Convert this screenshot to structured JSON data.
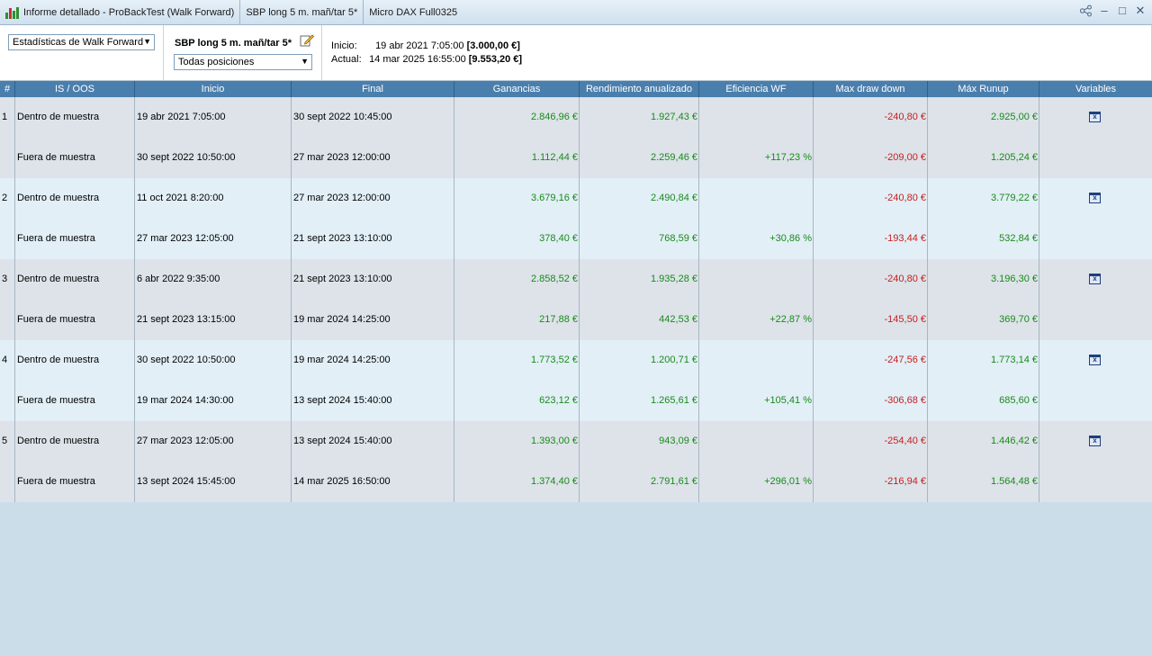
{
  "titlebar": {
    "tab1": "Informe detallado - ProBackTest (Walk Forward)",
    "tab2": "SBP long 5 m. mañ/tar 5*",
    "tab3": "Micro DAX Full0325"
  },
  "toolbar": {
    "view_select": "Estadísticas de Walk Forward",
    "strategy_name": "SBP long 5 m. mañ/tar 5*",
    "positions_select": "Todas posiciones",
    "inicio_label": "Inicio:",
    "inicio_date": "19 abr 2021 7:05:00",
    "inicio_amount": "[3.000,00 €]",
    "actual_label": "Actual:",
    "actual_date": "14 mar 2025 16:55:00",
    "actual_amount": "[9.553,20 €]"
  },
  "table": {
    "headers": [
      "#",
      "IS / OOS",
      "Inicio",
      "Final",
      "Ganancias",
      "Rendimiento anualizado",
      "Eficiencia WF",
      "Max draw down",
      "Máx Runup",
      "Variables"
    ],
    "rows": [
      {
        "num": "1",
        "type": "Dentro de muestra",
        "start": "19 abr 2021 7:05:00",
        "end": "30 sept 2022 10:45:00",
        "gain": "2.846,96 €",
        "annual": "1.927,43 €",
        "eff": "",
        "dd": "-240,80 €",
        "runup": "2.925,00 €",
        "var": true
      },
      {
        "num": "",
        "type": "Fuera de muestra",
        "start": "30 sept 2022 10:50:00",
        "end": "27 mar 2023 12:00:00",
        "gain": "1.112,44 €",
        "annual": "2.259,46 €",
        "eff": "+117,23 %",
        "dd": "-209,00 €",
        "runup": "1.205,24 €",
        "var": false
      },
      {
        "num": "2",
        "type": "Dentro de muestra",
        "start": "11 oct 2021 8:20:00",
        "end": "27 mar 2023 12:00:00",
        "gain": "3.679,16 €",
        "annual": "2.490,84 €",
        "eff": "",
        "dd": "-240,80 €",
        "runup": "3.779,22 €",
        "var": true
      },
      {
        "num": "",
        "type": "Fuera de muestra",
        "start": "27 mar 2023 12:05:00",
        "end": "21 sept 2023 13:10:00",
        "gain": "378,40 €",
        "annual": "768,59 €",
        "eff": "+30,86 %",
        "dd": "-193,44 €",
        "runup": "532,84 €",
        "var": false
      },
      {
        "num": "3",
        "type": "Dentro de muestra",
        "start": "6 abr 2022 9:35:00",
        "end": "21 sept 2023 13:10:00",
        "gain": "2.858,52 €",
        "annual": "1.935,28 €",
        "eff": "",
        "dd": "-240,80 €",
        "runup": "3.196,30 €",
        "var": true
      },
      {
        "num": "",
        "type": "Fuera de muestra",
        "start": "21 sept 2023 13:15:00",
        "end": "19 mar 2024 14:25:00",
        "gain": "217,88 €",
        "annual": "442,53 €",
        "eff": "+22,87 %",
        "dd": "-145,50 €",
        "runup": "369,70 €",
        "var": false
      },
      {
        "num": "4",
        "type": "Dentro de muestra",
        "start": "30 sept 2022 10:50:00",
        "end": "19 mar 2024 14:25:00",
        "gain": "1.773,52 €",
        "annual": "1.200,71 €",
        "eff": "",
        "dd": "-247,56 €",
        "runup": "1.773,14 €",
        "var": true
      },
      {
        "num": "",
        "type": "Fuera de muestra",
        "start": "19 mar 2024 14:30:00",
        "end": "13 sept 2024 15:40:00",
        "gain": "623,12 €",
        "annual": "1.265,61 €",
        "eff": "+105,41 %",
        "dd": "-306,68 €",
        "runup": "685,60 €",
        "var": false
      },
      {
        "num": "5",
        "type": "Dentro de muestra",
        "start": "27 mar 2023 12:05:00",
        "end": "13 sept 2024 15:40:00",
        "gain": "1.393,00 €",
        "annual": "943,09 €",
        "eff": "",
        "dd": "-254,40 €",
        "runup": "1.446,42 €",
        "var": true
      },
      {
        "num": "",
        "type": "Fuera de muestra",
        "start": "13 sept 2024 15:45:00",
        "end": "14 mar 2025 16:50:00",
        "gain": "1.374,40 €",
        "annual": "2.791,61 €",
        "eff": "+296,01 %",
        "dd": "-216,94 €",
        "runup": "1.564,48 €",
        "var": false
      }
    ]
  },
  "colors": {
    "header_bg": "#4a7fad",
    "group_odd_bg": "#dde3e9",
    "group_even_bg": "#e2eff7",
    "positive": "#1a8a1a",
    "negative": "#c81e1e",
    "empty_area": "#cbdde8"
  },
  "icons": {
    "app": "candlestick-chart-icon",
    "share": "share-icon",
    "minimize": "minimize-icon",
    "maximize": "maximize-icon",
    "close": "close-icon",
    "edit": "pencil-edit-icon",
    "variables": "spreadsheet-icon"
  }
}
